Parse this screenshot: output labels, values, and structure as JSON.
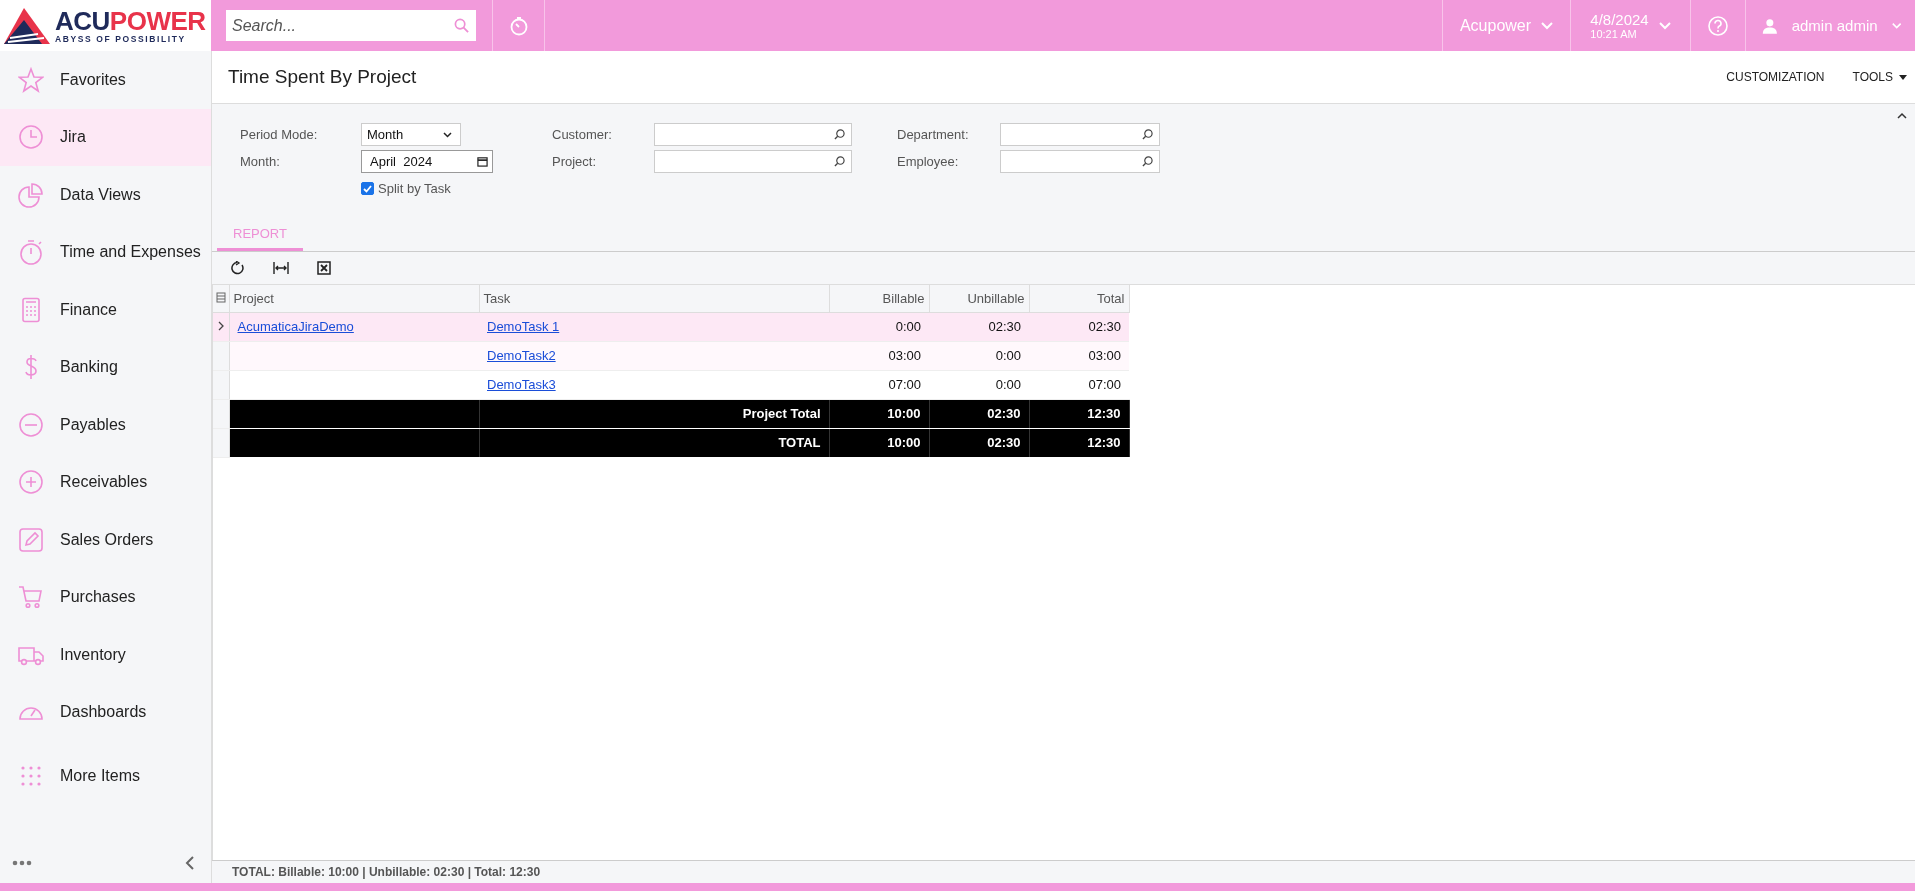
{
  "logo": {
    "brand_parts": [
      {
        "text": "ACU",
        "color": "#1f2a5a"
      },
      {
        "text": "POWER",
        "color": "#e8334a"
      }
    ],
    "tagline": "ABYSS OF POSSIBILITY"
  },
  "top_bar": {
    "search": {
      "placeholder": "Search..."
    },
    "company": "Acupower",
    "date": "4/8/2024",
    "time": "10:21 AM",
    "user": "admin admin"
  },
  "sidebar": {
    "items": [
      {
        "label": "Favorites",
        "kind": "star",
        "selected": false
      },
      {
        "label": "Jira",
        "kind": "clock",
        "selected": true
      },
      {
        "label": "Data Views",
        "kind": "pie",
        "selected": false
      },
      {
        "label": "Time and Expenses",
        "kind": "stopwatch",
        "selected": false
      },
      {
        "label": "Finance",
        "kind": "calculator",
        "selected": false
      },
      {
        "label": "Banking",
        "kind": "dollar",
        "selected": false
      },
      {
        "label": "Payables",
        "kind": "minus",
        "selected": false
      },
      {
        "label": "Receivables",
        "kind": "plus",
        "selected": false
      },
      {
        "label": "Sales Orders",
        "kind": "pencil",
        "selected": false
      },
      {
        "label": "Purchases",
        "kind": "cart",
        "selected": false
      },
      {
        "label": "Inventory",
        "kind": "truck",
        "selected": false
      },
      {
        "label": "Dashboards",
        "kind": "gauge",
        "selected": false
      },
      {
        "label": "More Items",
        "kind": "dots",
        "selected": false
      }
    ]
  },
  "page": {
    "title": "Time Spent By Project",
    "actions": [
      {
        "label": "CUSTOMIZATION",
        "dropdown": false
      },
      {
        "label": "TOOLS",
        "dropdown": true
      }
    ]
  },
  "filters": {
    "period_mode": {
      "label": "Period Mode:",
      "value": "Month"
    },
    "month": {
      "label": "Month:",
      "value": "April  2024"
    },
    "split_by_task": {
      "label": "Split by Task",
      "checked": true
    },
    "lookups": [
      {
        "label": "Customer:"
      },
      {
        "label": "Project:"
      },
      {
        "label": "Department:"
      },
      {
        "label": "Employee:"
      }
    ]
  },
  "tabs": [
    {
      "label": "REPORT",
      "selected": true
    }
  ],
  "table": {
    "columns": [
      "Project",
      "Task",
      "Billable",
      "Unbillable",
      "Total"
    ],
    "rows": [
      {
        "kind": "detail",
        "selected": true,
        "expandable": true,
        "cells": [
          "AcumaticaJiraDemo",
          "DemoTask 1",
          "0:00",
          "02:30",
          "02:30"
        ]
      },
      {
        "kind": "detail",
        "selected": false,
        "expandable": false,
        "cells": [
          "",
          "DemoTask2",
          "03:00",
          "0:00",
          "03:00"
        ]
      },
      {
        "kind": "detail",
        "selected": false,
        "expandable": false,
        "cells": [
          "",
          "DemoTask3",
          "07:00",
          "0:00",
          "07:00"
        ]
      },
      {
        "kind": "total",
        "selected": false,
        "expandable": false,
        "cells": [
          "",
          "Project Total",
          "10:00",
          "02:30",
          "12:30"
        ]
      },
      {
        "kind": "total",
        "selected": false,
        "expandable": false,
        "cells": [
          "",
          "TOTAL",
          "10:00",
          "02:30",
          "12:30"
        ]
      }
    ]
  },
  "status_bar": "TOTAL: Billable: 10:00 | Unbillable: 02:30 | Total: 12:30"
}
